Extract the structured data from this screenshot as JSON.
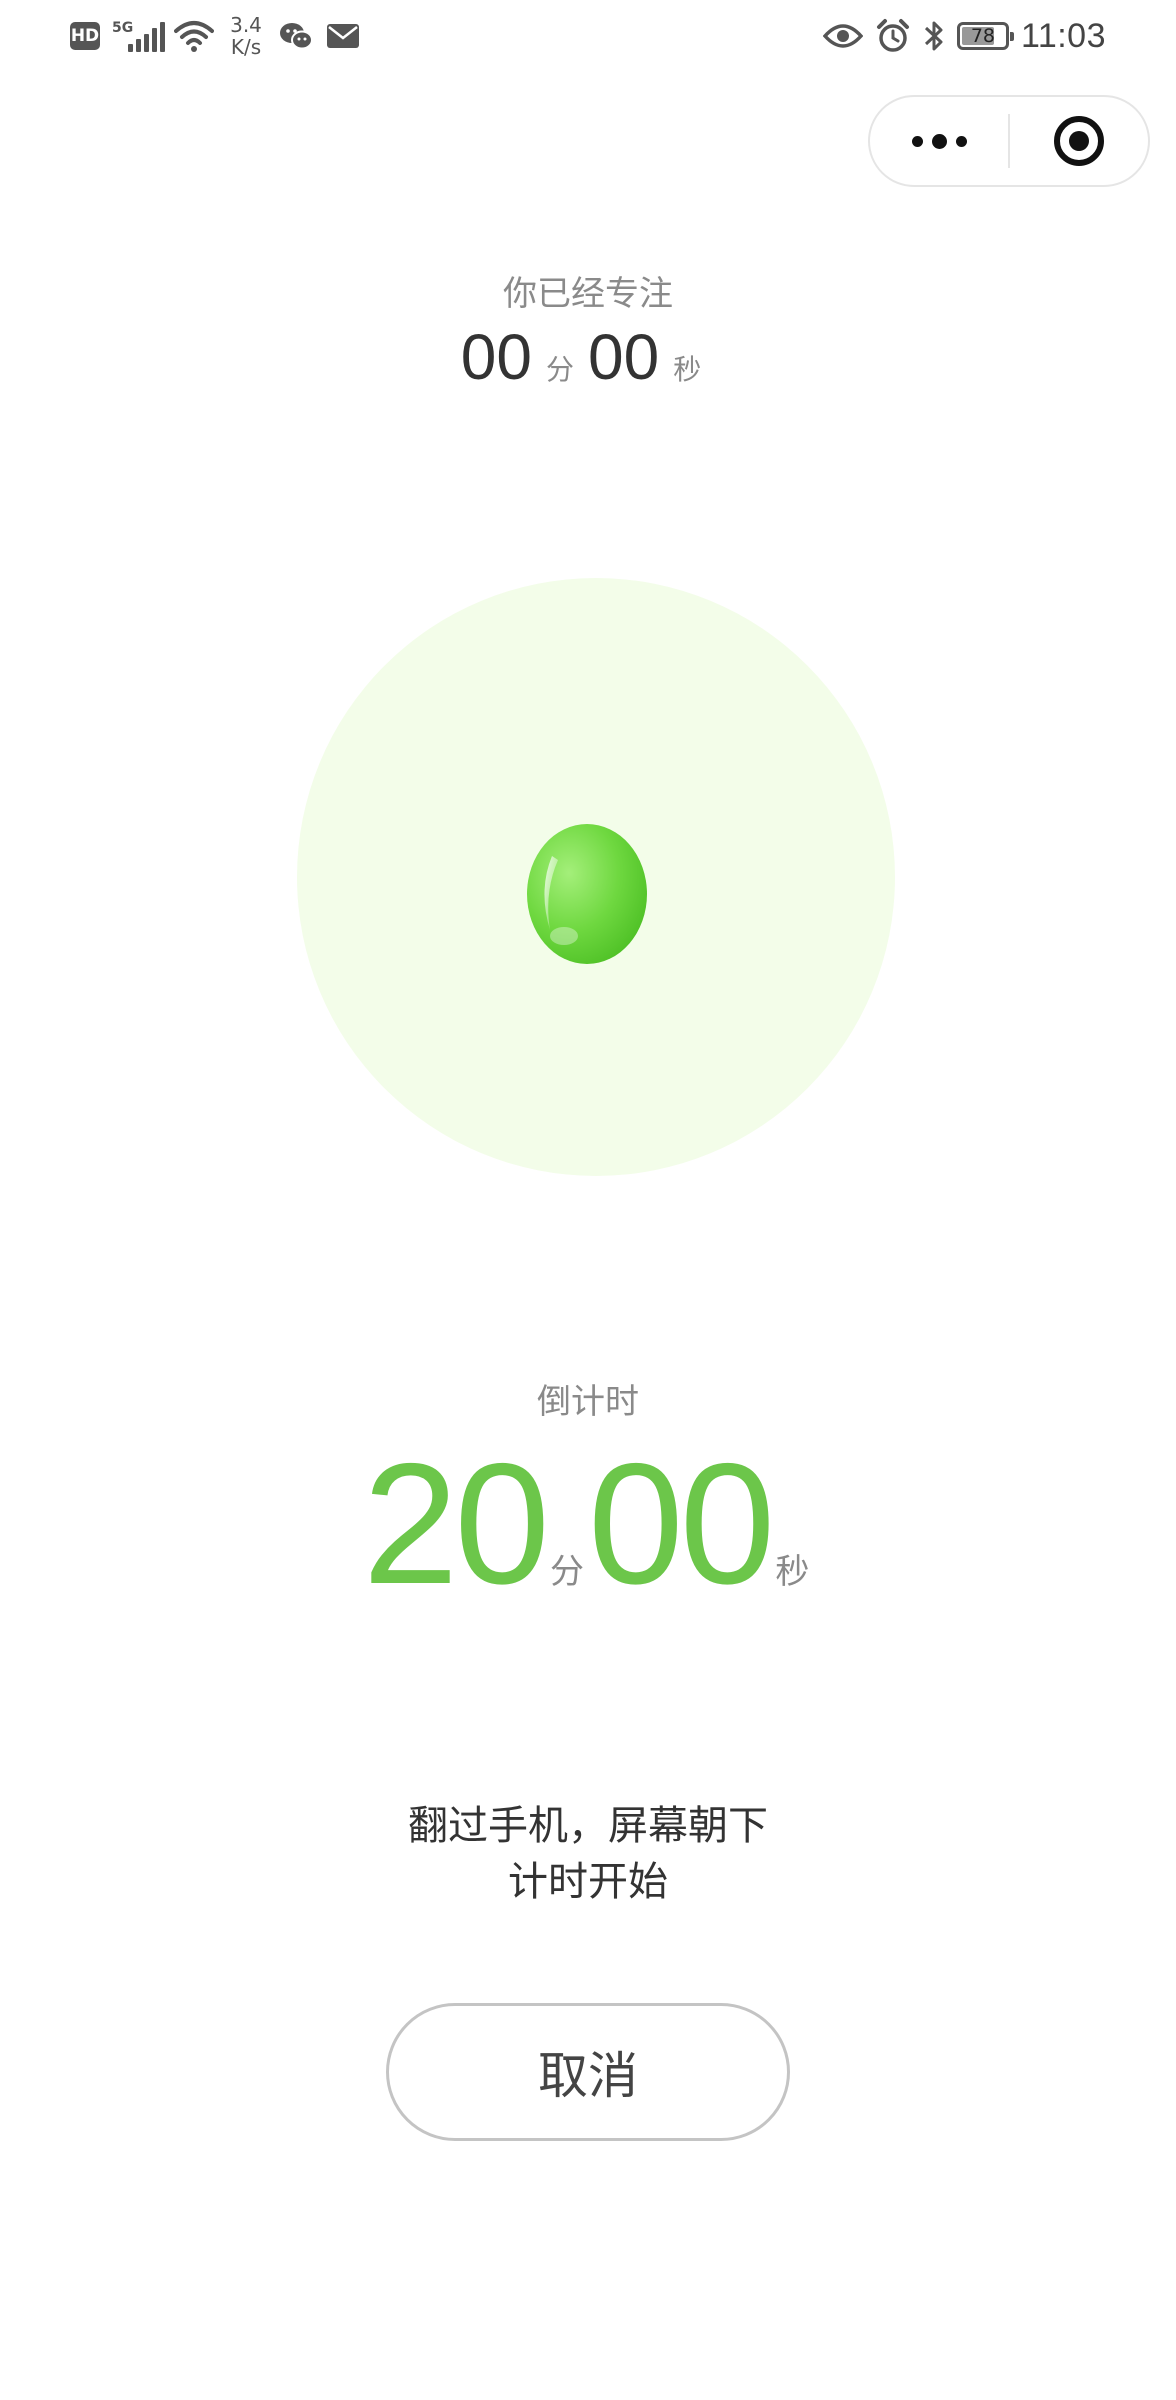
{
  "status_bar": {
    "hd": "HD",
    "network_type": "5G",
    "net_speed_value": "3.4",
    "net_speed_unit": "K/s",
    "battery_level": "78",
    "time": "11:03",
    "icons": [
      "hd-icon",
      "signal-5g-icon",
      "wifi-icon",
      "wechat-icon",
      "mail-icon",
      "eye-icon",
      "alarm-icon",
      "bluetooth-icon",
      "battery-icon"
    ]
  },
  "capsule": {
    "icons": [
      "more-dots-icon",
      "target-icon"
    ]
  },
  "focus": {
    "label": "你已经专注",
    "minutes": "00",
    "minutes_unit": "分",
    "seconds": "00",
    "seconds_unit": "秒"
  },
  "countdown": {
    "label": "倒计时",
    "minutes": "20",
    "minutes_unit": "分",
    "seconds": "00",
    "seconds_unit": "秒",
    "color": "#6cc64a"
  },
  "hint": {
    "line1": "翻过手机，屏幕朝下",
    "line2": "计时开始"
  },
  "cancel_button": {
    "label": "取消"
  },
  "colors": {
    "accent_green": "#6cc64a",
    "circle_bg": "#f3fde9",
    "muted_text": "#8a8a8a"
  }
}
